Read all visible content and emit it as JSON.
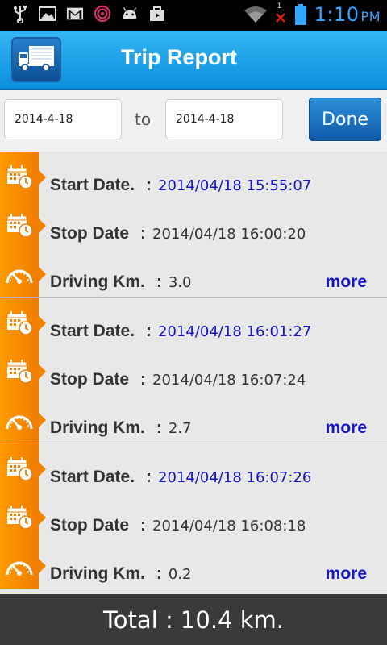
{
  "status_bar": {
    "time": "1:10",
    "ampm": "PM",
    "icons": [
      "usb-icon",
      "image-icon",
      "gmail-icon",
      "fingerprint-icon",
      "android-icon",
      "shopping-bag-icon",
      "wifi-icon",
      "no-signal-icon",
      "battery-icon"
    ],
    "signal_badge": "1"
  },
  "app": {
    "title": "Trip Report",
    "logo_icon": "truck-icon"
  },
  "filter": {
    "from_date": "2014-4-18",
    "to_label": "to",
    "to_date": "2014-4-18",
    "done_label": "Done"
  },
  "records": [
    {
      "start_label": "Start Date.",
      "start_value": "2014/04/18 15:55:07",
      "stop_label": "Stop Date",
      "stop_value": "2014/04/18 16:00:20",
      "km_label": "Driving Km.",
      "km_value": "3.0",
      "more_label": "more"
    },
    {
      "start_label": "Start Date.",
      "start_value": "2014/04/18 16:01:27",
      "stop_label": "Stop Date",
      "stop_value": "2014/04/18 16:07:24",
      "km_label": "Driving Km.",
      "km_value": "2.7",
      "more_label": "more"
    },
    {
      "start_label": "Start Date.",
      "start_value": "2014/04/18 16:07:26",
      "stop_label": "Stop Date",
      "stop_value": "2014/04/18 16:08:18",
      "km_label": "Driving Km.",
      "km_value": "0.2",
      "more_label": "more"
    }
  ],
  "total": {
    "text": "Total  : 10.4 km."
  },
  "colors": {
    "accent_blue": "#0c8ede",
    "stripe_orange": "#f28400",
    "link_blue": "#1414c8",
    "time_blue": "#2ea6ff"
  }
}
